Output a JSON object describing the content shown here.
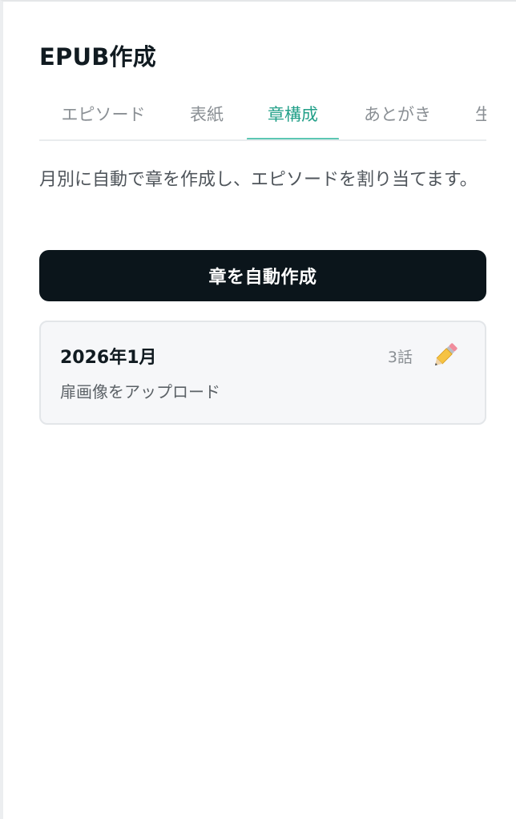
{
  "header": {
    "title": "EPUB作成"
  },
  "tabs": [
    {
      "label": "エピソード",
      "active": false
    },
    {
      "label": "表紙",
      "active": false
    },
    {
      "label": "章構成",
      "active": true
    },
    {
      "label": "あとがき",
      "active": false
    },
    {
      "label": "生成",
      "active": false
    }
  ],
  "main": {
    "description": "月別に自動で章を作成し、エピソードを割り当てます。",
    "auto_button_label": "章を自動作成",
    "chapters": [
      {
        "title": "2026年1月",
        "count": "3話",
        "action": "扉画像をアップロード",
        "edit_icon": "pencil-icon"
      }
    ]
  },
  "colors": {
    "accent": "#23a089",
    "tab_underline": "#5cc7b3",
    "button_bg": "#0b151b",
    "card_bg": "#f6f7f9"
  }
}
